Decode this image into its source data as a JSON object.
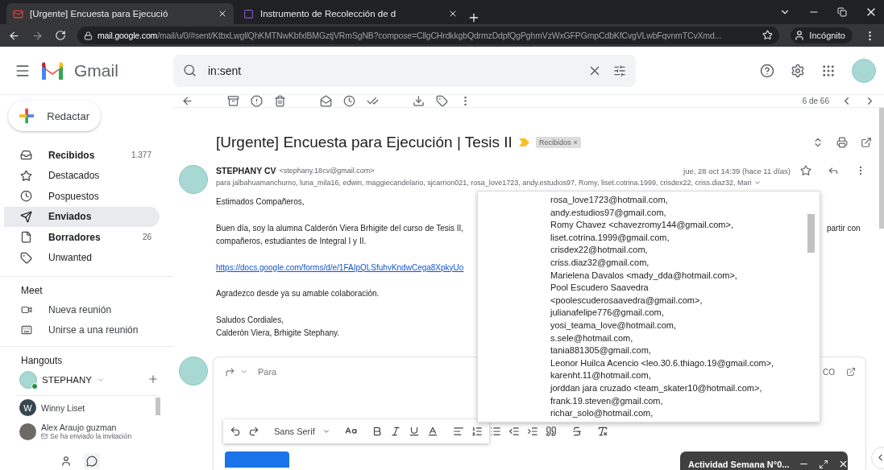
{
  "browser": {
    "tabs": [
      {
        "title": "[Urgente] Encuesta para Ejecució",
        "selected": true
      },
      {
        "title": "Instrumento de Recolección de d",
        "selected": false
      }
    ],
    "url_host": "mail.google.com",
    "url_path": "/mail/u/0/#sent/KtbxLwgllQhKMTNwKbfxlBMGztjVRmSgNB?compose=CllgCHrdkkgbQdrmzDdpfQgPghmVzWxGFPGmpCdbKfCvgVLwbFqvnmTCvXmd...",
    "profile_label": "Incógnito"
  },
  "header": {
    "product": "Gmail",
    "search_value": "in:sent"
  },
  "sidebar": {
    "compose_label": "Redactar",
    "folders": [
      {
        "label": "Recibidos",
        "count": "1.377",
        "unread": true,
        "selected": false
      },
      {
        "label": "Destacados",
        "unread": false,
        "selected": false
      },
      {
        "label": "Pospuestos",
        "unread": false,
        "selected": false
      },
      {
        "label": "Enviados",
        "unread": true,
        "selected": true
      },
      {
        "label": "Borradores",
        "count": "26",
        "unread": true,
        "selected": false
      },
      {
        "label": "Unwanted",
        "unread": false,
        "selected": false
      }
    ],
    "meet": {
      "heading": "Meet",
      "items": [
        "Nueva reunión",
        "Unirse a una reunión"
      ]
    },
    "hangouts": {
      "heading": "Hangouts",
      "user": "STEPHANY",
      "online": true,
      "contacts": [
        {
          "kind": "letter",
          "initial": "W",
          "name": "Winny Liset"
        },
        {
          "kind": "photo",
          "name": "Alex Araujo guzman",
          "status": "Se ha enviado la invitación"
        }
      ]
    }
  },
  "toolbar": {
    "counter": "6 de 66"
  },
  "message": {
    "subject": "[Urgente] Encuesta para Ejecución | Tesis II",
    "label_chip": "Recibidos",
    "chip_close": "×",
    "sender_name": "STEPHANY CV",
    "sender_email": "<stephany.18cv@gmail.com>",
    "recipients": "para jalbahuamanchumo, luna_mila16, edwin, maggiecandelario, sjcarrion021, rosa_love1723, andy.estudios97, Romy, liset.cotrina.1999, crisdex22, criss.diaz32, Mari",
    "date": "jue, 28 oct 14:39 (hace 11 días)",
    "body": [
      {
        "kind": "text",
        "lines": [
          "Estimados Compañeros,"
        ]
      },
      {
        "kind": "text",
        "lines": [
          "Buen día, soy la alumna Calderón Viera Brhigite del curso de Tesis II,",
          "compañeros, estudiantes de Integral I y II."
        ],
        "cut_tail": "partir con"
      },
      {
        "kind": "link",
        "lines": [
          "https://docs.google.com/forms/d/e/1FAIpQLSfuhvKndwCega8XpkyUo"
        ]
      },
      {
        "kind": "text",
        "lines": [
          "Agradezco desde ya su amable colaboración."
        ]
      },
      {
        "kind": "text",
        "lines": [
          "Saludos Cordiales,",
          "Calderón Viera, Brhigite Stephany."
        ]
      }
    ]
  },
  "recipients_popup": [
    "rosa_love1723@hotmail.com,",
    "andy.estudios97@gmail.com,",
    "Romy Chavez <chavezromy144@gmail.com>,",
    "liset.cotrina.1999@gmail.com,",
    "crisdex22@hotmail.com,",
    "criss.diaz32@gmail.com,",
    "Marielena Davalos <mady_dda@hotmail.com>,",
    "Pool Escudero Saavedra",
    "<poolescuderosaavedra@gmail.com>,",
    "julianafelipe776@gmail.com,",
    "yosi_teama_love@hotmail.com,",
    "s.sele@hotmail.com,",
    "tania881305@gmail.com,",
    "Leonor Huilca Acencio <leo.30.6.thiago.19@gmail.com>,",
    "karenht.11@hotmail.com,",
    "jorddan jara cruzado <team_skater10@hotmail.com>,",
    "frank.19.steven@gmail.com,",
    "richar_solo@hotmail.com,"
  ],
  "compose": {
    "to_placeholder": "Para",
    "cut_label": "CO",
    "font": "Sans Serif"
  },
  "minimized_draft": {
    "title": "Actividad Semana N°0..."
  }
}
